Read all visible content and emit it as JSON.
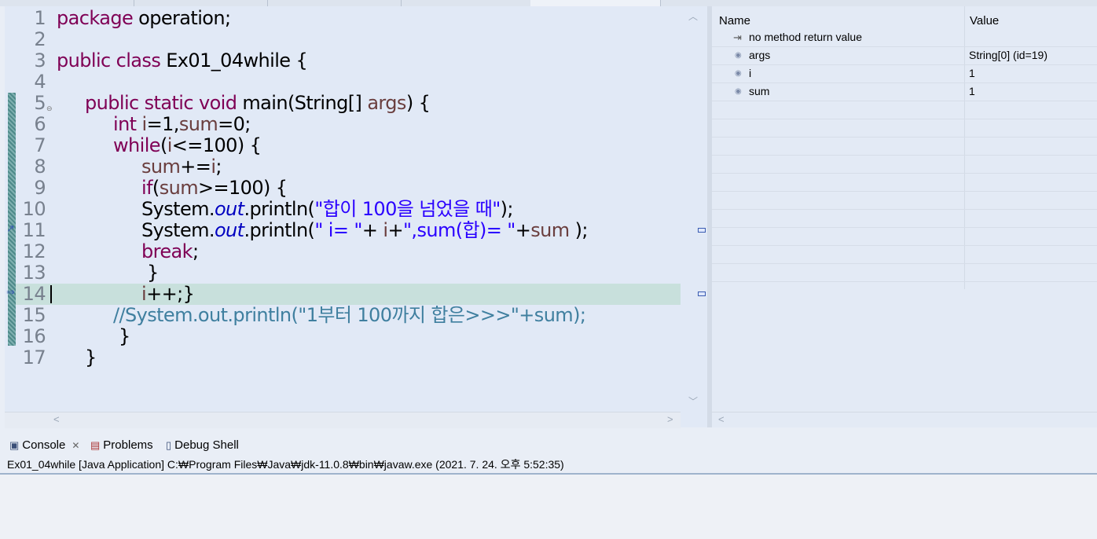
{
  "editor": {
    "lines": [
      {
        "n": "1",
        "indent": 0,
        "tokens": [
          [
            "kw",
            "package"
          ],
          [
            "pl",
            " operation;"
          ]
        ]
      },
      {
        "n": "2",
        "indent": 0,
        "tokens": []
      },
      {
        "n": "3",
        "indent": 0,
        "tokens": [
          [
            "kw",
            "public class"
          ],
          [
            "pl",
            " Ex01_04while {"
          ]
        ]
      },
      {
        "n": "4",
        "indent": 0,
        "tokens": []
      },
      {
        "n": "5",
        "indent": 1,
        "tokens": [
          [
            "kw",
            "public static void"
          ],
          [
            "pl",
            " main(String[] "
          ],
          [
            "vr",
            "args"
          ],
          [
            "pl",
            ") {"
          ]
        ]
      },
      {
        "n": "6",
        "indent": 2,
        "tokens": [
          [
            "kw",
            "int"
          ],
          [
            "pl",
            " "
          ],
          [
            "vr",
            "i"
          ],
          [
            "pl",
            "=1,"
          ],
          [
            "vr",
            "sum"
          ],
          [
            "pl",
            "=0;"
          ]
        ]
      },
      {
        "n": "7",
        "indent": 2,
        "tokens": [
          [
            "kw",
            "while"
          ],
          [
            "pl",
            "("
          ],
          [
            "vr",
            "i"
          ],
          [
            "pl",
            "<=100) {"
          ]
        ]
      },
      {
        "n": "8",
        "indent": 3,
        "tokens": [
          [
            "vr",
            "sum"
          ],
          [
            "pl",
            "+="
          ],
          [
            "vr",
            "i"
          ],
          [
            "pl",
            ";"
          ]
        ]
      },
      {
        "n": "9",
        "indent": 3,
        "tokens": [
          [
            "kw",
            "if"
          ],
          [
            "pl",
            "("
          ],
          [
            "vr",
            "sum"
          ],
          [
            "pl",
            ">=100) {"
          ]
        ]
      },
      {
        "n": "10",
        "indent": 3,
        "tokens": [
          [
            "pl",
            "System."
          ],
          [
            "fld",
            "out"
          ],
          [
            "pl",
            ".println("
          ],
          [
            "str",
            "\"합이 100을 넘었을 때\""
          ],
          [
            "pl",
            ");"
          ]
        ]
      },
      {
        "n": "11",
        "indent": 3,
        "tokens": [
          [
            "pl",
            "System."
          ],
          [
            "fld",
            "out"
          ],
          [
            "pl",
            ".println("
          ],
          [
            "str",
            "\" i= \""
          ],
          [
            "pl",
            "+ "
          ],
          [
            "vr",
            "i"
          ],
          [
            "pl",
            "+"
          ],
          [
            "str",
            "\",sum(합)= \""
          ],
          [
            "pl",
            "+"
          ],
          [
            "vr",
            "sum"
          ],
          [
            "pl",
            " );"
          ]
        ]
      },
      {
        "n": "12",
        "indent": 3,
        "tokens": [
          [
            "kw",
            "break"
          ],
          [
            "pl",
            ";"
          ]
        ]
      },
      {
        "n": "13",
        "indent": 3,
        "tokens": [
          [
            "pl",
            " }"
          ]
        ]
      },
      {
        "n": "14",
        "indent": 3,
        "tokens": [
          [
            "vr",
            "i"
          ],
          [
            "pl",
            "++;}"
          ]
        ],
        "current": true
      },
      {
        "n": "15",
        "indent": 2,
        "tokens": [
          [
            "cm",
            "//System.out.println(\"1부터 100까지 합은>>>\"+sum);"
          ]
        ]
      },
      {
        "n": "16",
        "indent": 2,
        "tokens": [
          [
            "pl",
            " }"
          ]
        ]
      },
      {
        "n": "17",
        "indent": 1,
        "tokens": [
          [
            "pl",
            "}"
          ]
        ]
      }
    ]
  },
  "variables": {
    "col_name": "Name",
    "col_value": "Value",
    "rows": [
      {
        "name": "no method return value",
        "value": "",
        "icon": "return-icon"
      },
      {
        "name": "args",
        "value": "String[0]  (id=19)",
        "icon": "local-variable-icon"
      },
      {
        "name": "i",
        "value": "1",
        "icon": "local-variable-icon"
      },
      {
        "name": "sum",
        "value": "1",
        "icon": "local-variable-icon"
      }
    ]
  },
  "bottom": {
    "tabs": [
      {
        "label": "Console",
        "icon": "console-icon",
        "closable": true
      },
      {
        "label": "Problems",
        "icon": "problems-icon",
        "closable": false
      },
      {
        "label": "Debug Shell",
        "icon": "debug-shell-icon",
        "closable": false
      }
    ],
    "console_header": "Ex01_04while [Java Application] C:₩Program Files₩Java₩jdk-11.0.8₩bin₩javaw.exe  (2021. 7. 24. 오후 5:52:35)"
  }
}
